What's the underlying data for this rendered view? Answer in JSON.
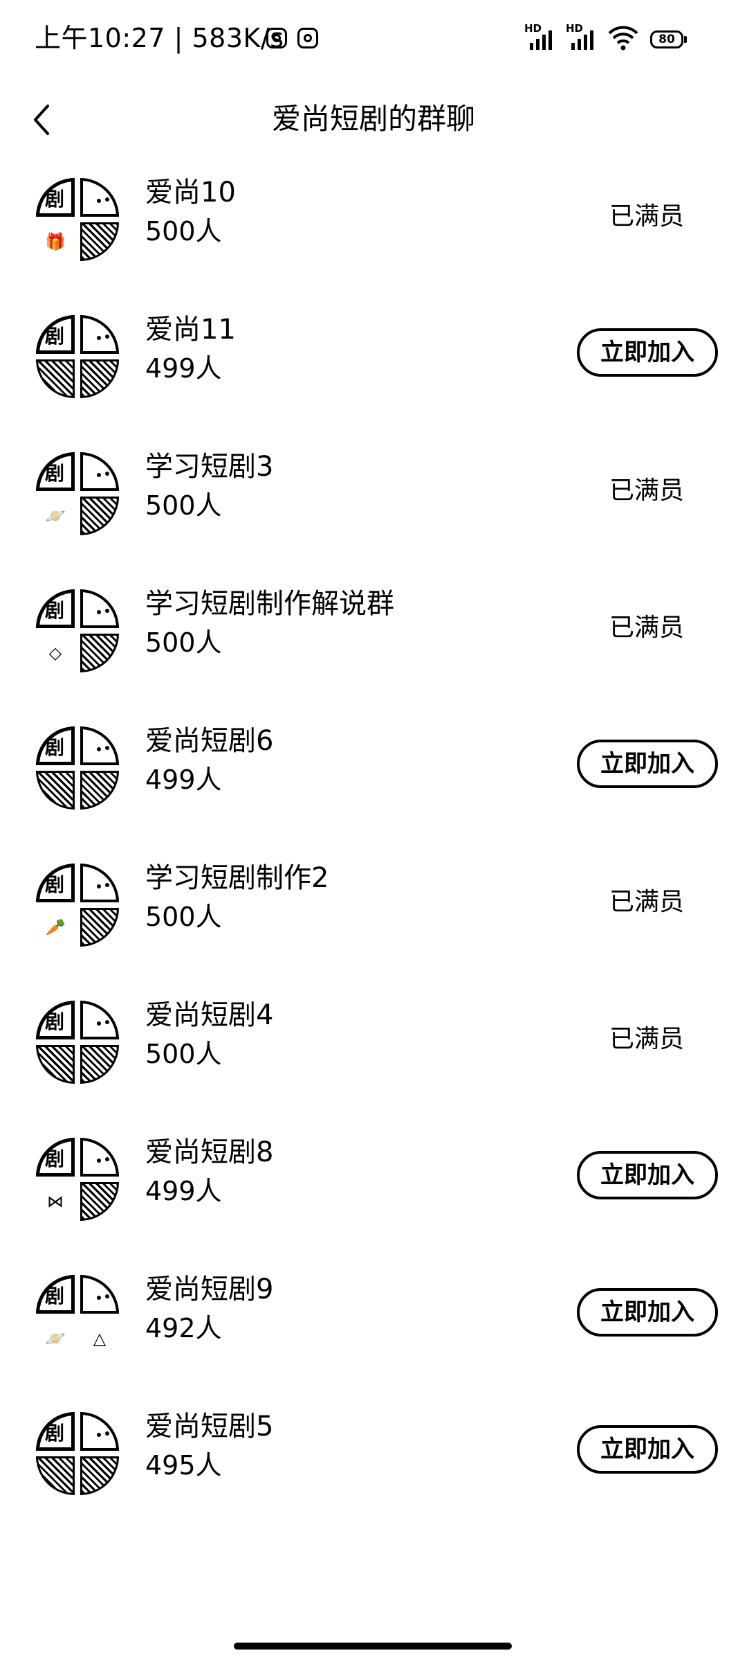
{
  "status_bar": {
    "time": "上午10:27",
    "net_speed": "583K/s",
    "signal1_label": "HD",
    "signal2_label": "HD",
    "battery": "80"
  },
  "header": {
    "title": "爱尚短剧的群聊",
    "back_icon": "chevron-left-icon"
  },
  "avatar_logo_char": "剧",
  "groups": [
    {
      "name": "爱尚10",
      "members": "500人",
      "status": "已满员",
      "join": ""
    },
    {
      "name": "爱尚11",
      "members": "499人",
      "status": "",
      "join": "立即加入"
    },
    {
      "name": "学习短剧3",
      "members": "500人",
      "status": "已满员",
      "join": ""
    },
    {
      "name": "学习短剧制作解说群",
      "members": "500人",
      "status": "已满员",
      "join": ""
    },
    {
      "name": "爱尚短剧6",
      "members": "499人",
      "status": "",
      "join": "立即加入"
    },
    {
      "name": "学习短剧制作2",
      "members": "500人",
      "status": "已满员",
      "join": ""
    },
    {
      "name": "爱尚短剧4",
      "members": "500人",
      "status": "已满员",
      "join": ""
    },
    {
      "name": "爱尚短剧8",
      "members": "499人",
      "status": "",
      "join": "立即加入"
    },
    {
      "name": "爱尚短剧9",
      "members": "492人",
      "status": "",
      "join": "立即加入"
    },
    {
      "name": "爱尚短剧5",
      "members": "495人",
      "status": "",
      "join": "立即加入"
    }
  ],
  "avatar_icons": [
    "gift-icon",
    "",
    "planet-icon",
    "diamond-icon",
    "",
    "carrot-icon",
    "",
    "bow-icon",
    "planet-icon",
    ""
  ],
  "avatar_icons_br": [
    "",
    "",
    "",
    "",
    "",
    "",
    "",
    "",
    "watermelon-icon",
    ""
  ]
}
